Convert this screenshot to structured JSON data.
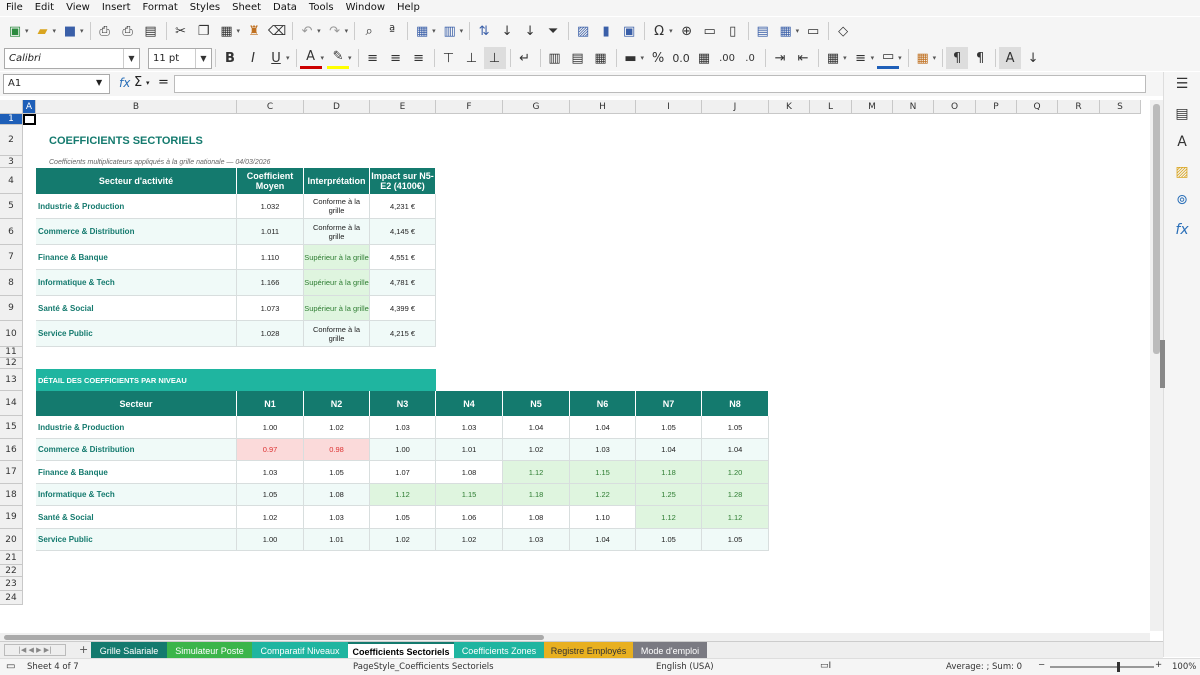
{
  "menu": [
    "File",
    "Edit",
    "View",
    "Insert",
    "Format",
    "Styles",
    "Sheet",
    "Data",
    "Tools",
    "Window",
    "Help"
  ],
  "font": {
    "name": "Calibri",
    "size": "11 pt"
  },
  "namebox": "A1",
  "columns": [
    "A",
    "B",
    "C",
    "D",
    "E",
    "F",
    "G",
    "H",
    "I",
    "J",
    "K",
    "L",
    "M",
    "N",
    "O",
    "P",
    "Q",
    "R",
    "S"
  ],
  "rows": [
    "1",
    "2",
    "3",
    "4",
    "5",
    "6",
    "7",
    "8",
    "9",
    "10",
    "11",
    "12",
    "13",
    "14",
    "15",
    "16",
    "17",
    "18",
    "19",
    "20",
    "21",
    "22",
    "23",
    "24"
  ],
  "sheet": {
    "title": "COEFFICIENTS SECTORIELS",
    "subtitle": "Coefficients multiplicateurs appliqués à la grille nationale — 04/03/2026",
    "table1": {
      "headers": [
        "Secteur d'activité",
        "Coefficient Moyen",
        "Interprétation",
        "Impact sur N5-E2 (4100€)"
      ],
      "rows": [
        [
          "Industrie & Production",
          "1.032",
          "Conforme à la grille",
          "4,231 €"
        ],
        [
          "Commerce & Distribution",
          "1.011",
          "Conforme à la grille",
          "4,145 €"
        ],
        [
          "Finance & Banque",
          "1.110",
          "Supérieur à la grille",
          "4,551 €"
        ],
        [
          "Informatique & Tech",
          "1.166",
          "Supérieur à la grille",
          "4,781 €"
        ],
        [
          "Santé & Social",
          "1.073",
          "Supérieur à la grille",
          "4,399 €"
        ],
        [
          "Service Public",
          "1.028",
          "Conforme à la grille",
          "4,215 €"
        ]
      ]
    },
    "banner": "DÉTAIL DES COEFFICIENTS PAR NIVEAU",
    "table2": {
      "headers": [
        "Secteur",
        "N1",
        "N2",
        "N3",
        "N4",
        "N5",
        "N6",
        "N7",
        "N8"
      ],
      "rows": [
        [
          "Industrie & Production",
          "1.00",
          "1.02",
          "1.03",
          "1.03",
          "1.04",
          "1.04",
          "1.05",
          "1.05"
        ],
        [
          "Commerce & Distribution",
          "0.97",
          "0.98",
          "1.00",
          "1.01",
          "1.02",
          "1.03",
          "1.04",
          "1.04"
        ],
        [
          "Finance & Banque",
          "1.03",
          "1.05",
          "1.07",
          "1.08",
          "1.12",
          "1.15",
          "1.18",
          "1.20"
        ],
        [
          "Informatique & Tech",
          "1.05",
          "1.08",
          "1.12",
          "1.15",
          "1.18",
          "1.22",
          "1.25",
          "1.28"
        ],
        [
          "Santé & Social",
          "1.02",
          "1.03",
          "1.05",
          "1.06",
          "1.08",
          "1.10",
          "1.12",
          "1.12"
        ],
        [
          "Service Public",
          "1.00",
          "1.01",
          "1.02",
          "1.02",
          "1.03",
          "1.04",
          "1.05",
          "1.05"
        ]
      ]
    }
  },
  "tabs": [
    {
      "label": "Grille Salariale",
      "bg": "#147a6e",
      "fg": "#ffffff"
    },
    {
      "label": "Simulateur Poste",
      "bg": "#3bb54a",
      "fg": "#ffffff"
    },
    {
      "label": "Comparatif Niveaux",
      "bg": "#1fb5a0",
      "fg": "#ffffff"
    },
    {
      "label": "Coefficients Sectoriels",
      "bg": "#ffffff",
      "fg": "#000000"
    },
    {
      "label": "Coefficients Zones",
      "bg": "#1fb5a0",
      "fg": "#ffffff"
    },
    {
      "label": "Registre Employés",
      "bg": "#e8b020",
      "fg": "#333333"
    },
    {
      "label": "Mode d'emploi",
      "bg": "#7a7a82",
      "fg": "#ffffff"
    }
  ],
  "status": {
    "sheet": "Sheet 4 of 7",
    "style": "PageStyle_Coefficients Sectoriels",
    "lang": "English (USA)",
    "sum": "Average: ; Sum: 0",
    "zoom": "100%"
  },
  "colors": {
    "header": "#147a6e",
    "banner": "#1fb5a0",
    "green": "#dff5df",
    "red": "#fbdada"
  }
}
